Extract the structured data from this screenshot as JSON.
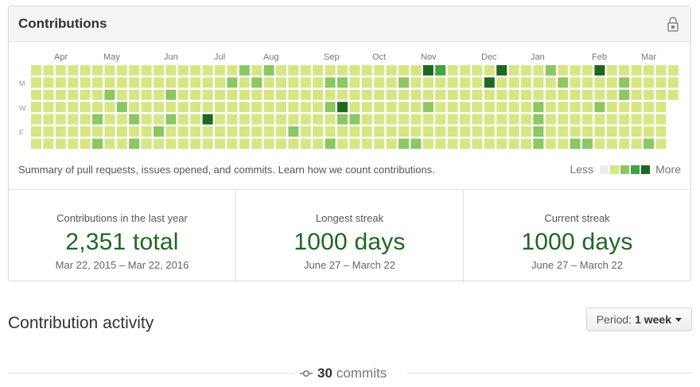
{
  "panel": {
    "title": "Contributions",
    "lock_icon": "lock-icon",
    "months": [
      "Apr",
      "May",
      "Jun",
      "Jul",
      "Aug",
      "Sep",
      "Oct",
      "Nov",
      "Dec",
      "Jan",
      "Feb",
      "Mar"
    ],
    "day_labels": [
      "M",
      "W",
      "F"
    ],
    "summary": "Summary of pull requests, issues opened, and commits. Learn how we count contributions.",
    "legend": {
      "less": "Less",
      "more": "More",
      "colors": [
        "#eeeeee",
        "#d6e685",
        "#8cc665",
        "#44a340",
        "#1e6823"
      ]
    },
    "calendar": {
      "weeks": 53,
      "days": 7,
      "last_week_days": 3,
      "palette": [
        "#eeeeee",
        "#d6e685",
        "#8cc665",
        "#44a340",
        "#1e6823"
      ],
      "levels": [
        [
          1,
          1,
          1,
          1,
          1,
          1,
          1,
          1,
          1,
          1,
          1,
          1,
          1,
          1,
          1,
          1,
          1,
          2,
          1,
          2,
          1,
          1,
          1,
          1,
          1,
          1,
          1,
          1,
          1,
          1,
          1,
          1,
          4,
          3,
          1,
          1,
          1,
          1,
          4,
          1,
          1,
          1,
          2,
          1,
          1,
          1,
          4,
          1,
          1,
          1,
          1,
          1,
          1
        ],
        [
          1,
          1,
          1,
          1,
          1,
          1,
          1,
          1,
          1,
          1,
          1,
          1,
          1,
          1,
          1,
          1,
          2,
          1,
          2,
          1,
          1,
          1,
          1,
          1,
          2,
          2,
          1,
          1,
          1,
          1,
          2,
          1,
          1,
          1,
          1,
          1,
          1,
          4,
          1,
          1,
          1,
          1,
          1,
          2,
          1,
          1,
          1,
          1,
          2,
          1,
          1,
          1,
          1
        ],
        [
          1,
          1,
          1,
          1,
          1,
          1,
          2,
          1,
          1,
          1,
          1,
          2,
          1,
          1,
          1,
          1,
          1,
          1,
          1,
          1,
          1,
          1,
          1,
          1,
          1,
          1,
          1,
          1,
          1,
          1,
          1,
          1,
          1,
          1,
          1,
          1,
          1,
          1,
          1,
          1,
          1,
          1,
          1,
          1,
          1,
          1,
          1,
          1,
          2,
          1,
          1,
          1,
          1
        ],
        [
          1,
          1,
          1,
          1,
          1,
          1,
          1,
          2,
          1,
          1,
          1,
          1,
          1,
          1,
          1,
          1,
          1,
          1,
          1,
          1,
          1,
          1,
          1,
          1,
          2,
          4,
          1,
          1,
          1,
          1,
          1,
          1,
          2,
          1,
          1,
          1,
          1,
          1,
          1,
          1,
          1,
          2,
          1,
          1,
          1,
          1,
          2,
          1,
          1,
          1,
          1,
          1,
          1
        ],
        [
          1,
          1,
          1,
          1,
          1,
          2,
          1,
          1,
          2,
          1,
          1,
          2,
          1,
          1,
          4,
          1,
          1,
          1,
          1,
          1,
          1,
          1,
          1,
          1,
          1,
          2,
          2,
          1,
          1,
          1,
          1,
          1,
          1,
          1,
          1,
          1,
          1,
          1,
          1,
          1,
          1,
          2,
          1,
          1,
          1,
          1,
          1,
          1,
          1,
          1,
          1,
          1,
          1
        ],
        [
          1,
          1,
          1,
          1,
          1,
          1,
          1,
          1,
          1,
          1,
          2,
          1,
          1,
          1,
          1,
          1,
          1,
          1,
          1,
          1,
          1,
          2,
          1,
          1,
          1,
          1,
          1,
          1,
          1,
          1,
          1,
          1,
          1,
          1,
          1,
          1,
          1,
          1,
          1,
          1,
          1,
          2,
          1,
          1,
          1,
          1,
          1,
          1,
          1,
          1,
          1,
          1,
          1
        ],
        [
          1,
          1,
          1,
          1,
          1,
          2,
          1,
          1,
          2,
          1,
          1,
          1,
          1,
          1,
          1,
          1,
          1,
          1,
          1,
          1,
          1,
          1,
          1,
          1,
          2,
          1,
          1,
          1,
          1,
          1,
          2,
          2,
          1,
          1,
          1,
          1,
          1,
          1,
          1,
          1,
          1,
          2,
          1,
          1,
          2,
          2,
          1,
          1,
          1,
          1,
          2,
          1,
          1
        ]
      ]
    }
  },
  "stats": [
    {
      "label": "Contributions in the last year",
      "value": "2,351 total",
      "range": "Mar 22, 2015 – Mar 22, 2016"
    },
    {
      "label": "Longest streak",
      "value": "1000 days",
      "range": "June 27 – March 22"
    },
    {
      "label": "Current streak",
      "value": "1000 days",
      "range": "June 27 – March 22"
    }
  ],
  "activity": {
    "title": "Contribution activity",
    "period_label": "Period:",
    "period_value": "1 week",
    "commit_count": "30",
    "commit_label": "commits",
    "commit_icon": "git-commit-icon"
  }
}
